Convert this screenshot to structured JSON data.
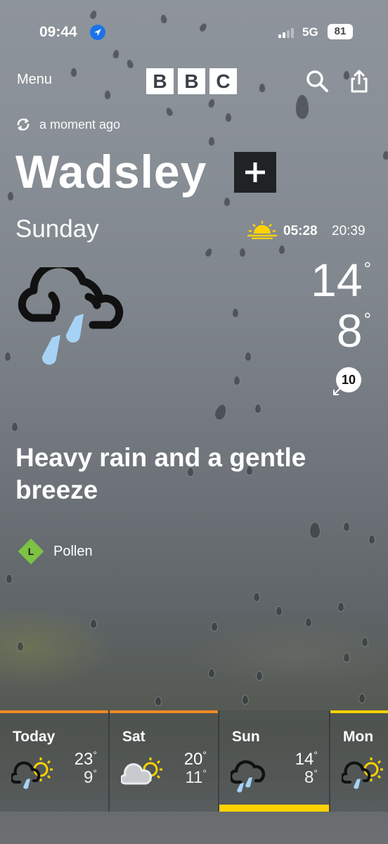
{
  "status_bar": {
    "time": "09:44",
    "network": "5G",
    "battery": "81"
  },
  "header": {
    "menu_label": "Menu",
    "brand": [
      "B",
      "B",
      "C"
    ]
  },
  "updated": {
    "text": "a moment ago"
  },
  "location": {
    "name": "Wadsley"
  },
  "current": {
    "day": "Sunday",
    "sunrise": "05:28",
    "sunset": "20:39",
    "temp_high": "14",
    "temp_low": "8",
    "degree_symbol": "°",
    "wind_speed": "10",
    "summary": "Heavy rain and a gentle breeze",
    "icon": "heavy-rain-cloud-icon"
  },
  "pollen": {
    "level": "L",
    "label": "Pollen",
    "color": "#7dc243"
  },
  "forecast": [
    {
      "day": "Today",
      "high": "23",
      "low": "9",
      "icon": "sun-cloud-rain-icon",
      "top_color": "#f08a24"
    },
    {
      "day": "Sat",
      "high": "20",
      "low": "11",
      "icon": "sun-cloud-icon",
      "top_color": "#f08a24"
    },
    {
      "day": "Sun",
      "high": "14",
      "low": "8",
      "icon": "rain-cloud-icon",
      "top_color": "",
      "selected_color": "#ffd200"
    },
    {
      "day": "Mon",
      "high": "",
      "low": "",
      "icon": "sun-cloud-rain-icon",
      "top_color": "#ffd200"
    }
  ],
  "colors": {
    "accent_orange": "#f08a24",
    "accent_yellow": "#ffd200",
    "rain_blue": "#a6d3f5"
  }
}
